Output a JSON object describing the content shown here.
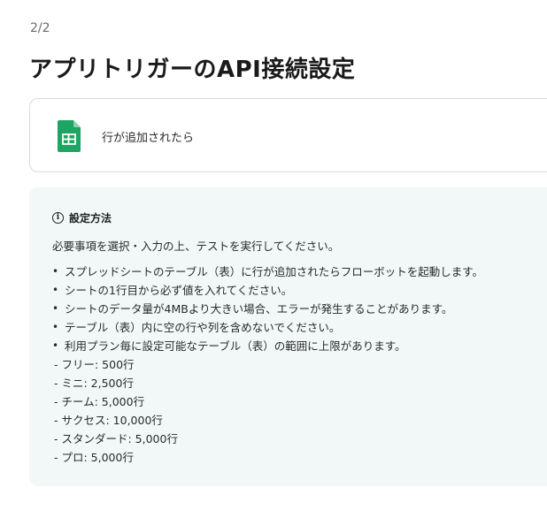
{
  "header": {
    "step_indicator": "2/2",
    "page_title": "アプリトリガーのAPI接続設定"
  },
  "trigger": {
    "icon": "google-sheets-icon",
    "label": "行が追加されたら"
  },
  "info": {
    "icon": "info-circle-icon",
    "title": "設定方法",
    "intro": "必要事項を選択・入力の上、テストを実行してください。",
    "bullets": [
      "スプレッドシートのテーブル（表）に行が追加されたらフローボットを起動します。",
      "シートの1行目から必ず値を入れてください。",
      "シートのデータ量が4MBより大きい場合、エラーが発生することがあります。",
      "テーブル（表）内に空の行や列を含めないでください。",
      "利用プラン毎に設定可能なテーブル（表）の範囲に上限があります。"
    ],
    "limits": [
      "- フリー: 500行",
      "- ミニ: 2,500行",
      "- チーム: 5,000行",
      "- サクセス: 10,000行",
      "- スタンダード: 5,000行",
      "- プロ: 5,000行"
    ]
  },
  "colors": {
    "sheets_green": "#1fa463",
    "info_bg": "#f1f8f7"
  }
}
